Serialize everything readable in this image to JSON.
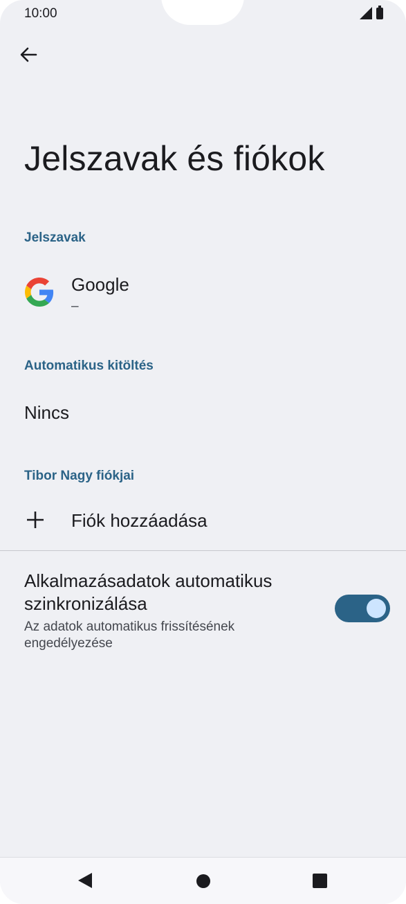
{
  "status_bar": {
    "time": "10:00"
  },
  "page": {
    "title": "Jelszavak és fiókok"
  },
  "passwords_section": {
    "header": "Jelszavak",
    "item": {
      "title": "Google",
      "subtitle": "–"
    }
  },
  "autofill_section": {
    "header": "Automatikus kitöltés",
    "value": "Nincs"
  },
  "accounts_section": {
    "header": "Tibor Nagy fiókjai",
    "add_account_label": "Fiók hozzáadása"
  },
  "sync": {
    "title": "Alkalmazásadatok automatikus szinkronizálása",
    "subtitle": "Az adatok automatikus frissítésének engedélyezése",
    "enabled": true
  },
  "colors": {
    "accent": "#2b6387",
    "background": "#eff0f4",
    "toggle_knob": "#cde5ff"
  },
  "icons": [
    "back-arrow-icon",
    "google-icon",
    "plus-icon",
    "nav-back-icon",
    "nav-home-icon",
    "nav-recents-icon"
  ]
}
